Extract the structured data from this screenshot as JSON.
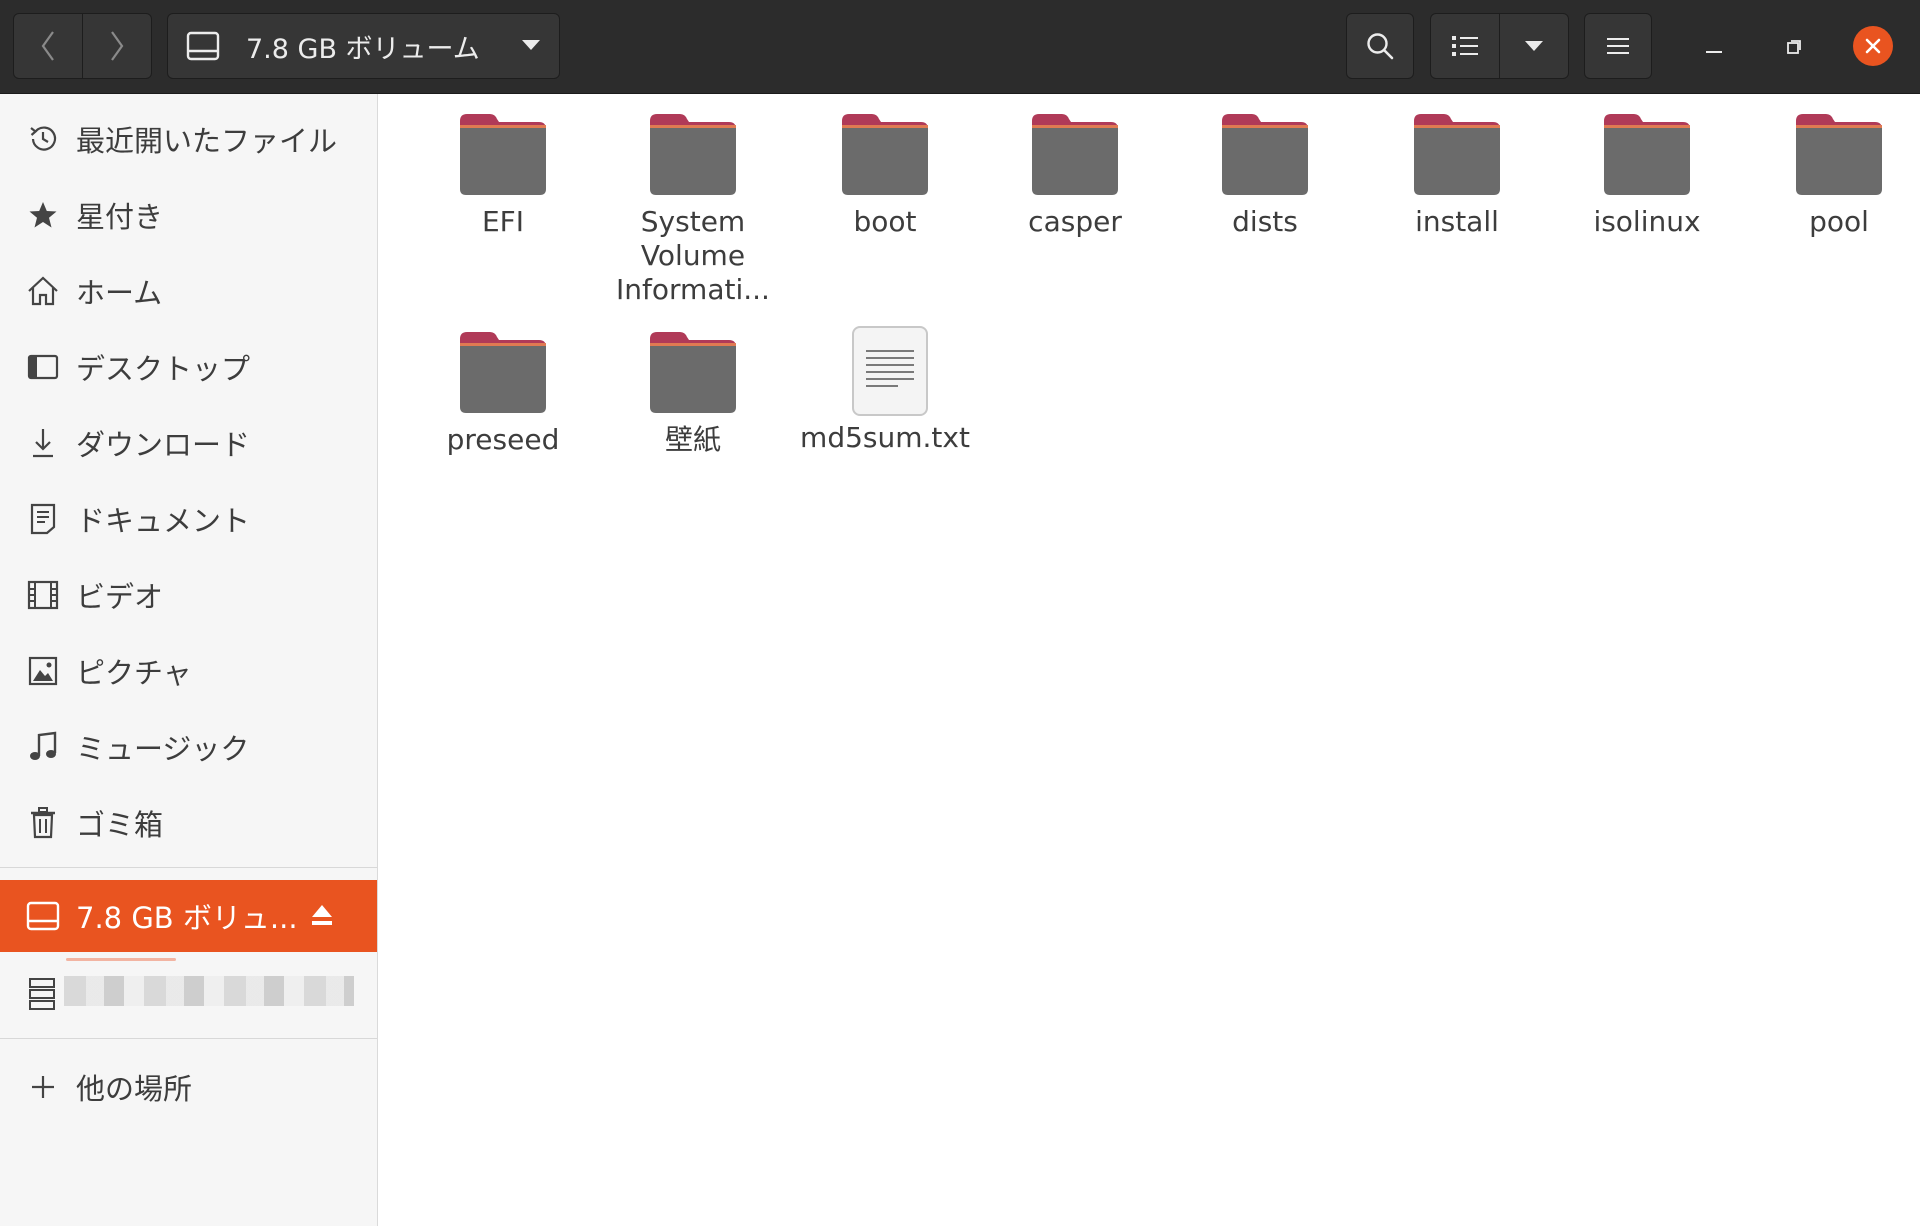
{
  "header": {
    "location_label": "7.8 GB ボリューム",
    "icons": {
      "back": "chevron-left-icon",
      "forward": "chevron-right-icon",
      "drive": "drive-icon",
      "location_dropdown": "caret-down-icon",
      "search": "search-icon",
      "list_view": "list-view-icon",
      "view_options": "caret-down-icon",
      "menu": "hamburger-icon",
      "minimize": "minimize-icon",
      "maximize": "maximize-icon",
      "close": "close-icon"
    }
  },
  "sidebar": {
    "items": [
      {
        "label": "最近開いたファイル",
        "icon": "clock-icon"
      },
      {
        "label": "星付き",
        "icon": "star-icon"
      },
      {
        "label": "ホーム",
        "icon": "home-icon"
      },
      {
        "label": "デスクトップ",
        "icon": "desktop-icon"
      },
      {
        "label": "ダウンロード",
        "icon": "download-icon"
      },
      {
        "label": "ドキュメント",
        "icon": "document-icon"
      },
      {
        "label": "ビデオ",
        "icon": "video-icon"
      },
      {
        "label": "ピクチャ",
        "icon": "picture-icon"
      },
      {
        "label": "ミュージック",
        "icon": "music-icon"
      },
      {
        "label": "ゴミ箱",
        "icon": "trash-icon"
      }
    ],
    "devices": [
      {
        "label": "7.8 GB ボリュ...",
        "icon": "drive-icon",
        "active": true
      },
      {
        "label": "",
        "icon": "network-server-icon",
        "redacted": true
      }
    ],
    "other_locations": {
      "label": "他の場所",
      "icon": "plus-icon"
    }
  },
  "files": [
    {
      "name": "EFI",
      "type": "folder"
    },
    {
      "name": "System Volume Informati...",
      "type": "folder"
    },
    {
      "name": "boot",
      "type": "folder"
    },
    {
      "name": "casper",
      "type": "folder"
    },
    {
      "name": "dists",
      "type": "folder"
    },
    {
      "name": "install",
      "type": "folder"
    },
    {
      "name": "isolinux",
      "type": "folder"
    },
    {
      "name": "pool",
      "type": "folder"
    },
    {
      "name": "preseed",
      "type": "folder"
    },
    {
      "name": "壁紙",
      "type": "folder"
    },
    {
      "name": "md5sum.txt",
      "type": "text-file"
    }
  ],
  "colors": {
    "accent": "#e95420",
    "headerbar": "#2c2c2c",
    "sidebar_bg": "#f6f6f6",
    "folder_body": "#6b6b6b",
    "folder_tab": "#b03a58"
  }
}
